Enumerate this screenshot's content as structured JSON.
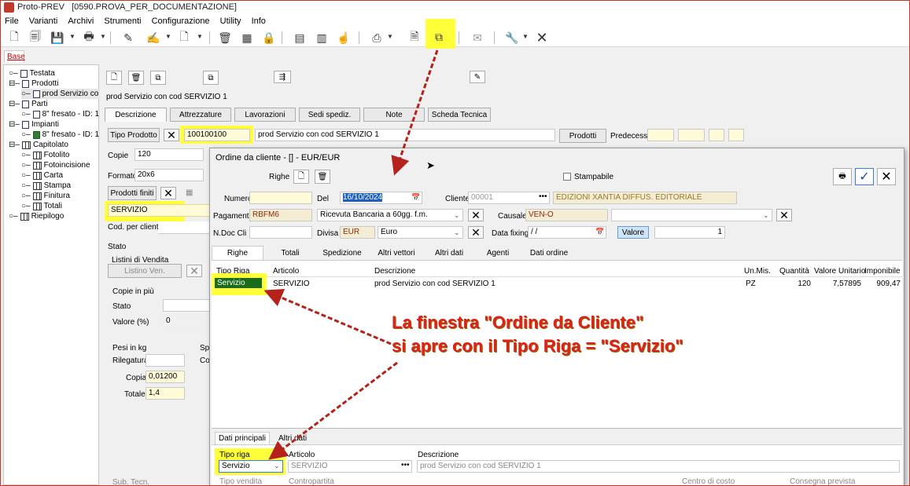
{
  "window": {
    "app_name": "Proto-PREV",
    "doc_name": "[0590.PROVA_PER_DOCUMENTAZIONE]"
  },
  "menu": [
    "File",
    "Varianti",
    "Archivi",
    "Strumenti",
    "Configurazione",
    "Utility",
    "Info"
  ],
  "toolbar_icons": [
    "new-doc-icon",
    "open-icon",
    "save-icon",
    "print-icon",
    "edit-icon",
    "edit-doc-icon",
    "page-icon",
    "trash-icon",
    "calc-icon",
    "lock-icon",
    "table-icon",
    "table-edit-icon",
    "hand-icon",
    "stamp-icon",
    "pdf-icon",
    "copy-order-icon",
    "mail-icon",
    "wrench-icon",
    "close-icon"
  ],
  "base_tab": "Base",
  "tree": {
    "items": [
      {
        "label": "Testata",
        "icon": "doc"
      },
      {
        "label": "Prodotti",
        "icon": "doc"
      },
      {
        "label": "prod Servizio co",
        "icon": "doc"
      },
      {
        "label": "Parti",
        "icon": "doc"
      },
      {
        "label": "8\" fresato - ID: 1",
        "icon": "doc"
      },
      {
        "label": "Impianti",
        "icon": "doc"
      },
      {
        "label": "8\" fresato - ID: 1",
        "icon": "green"
      },
      {
        "label": "Capitolato",
        "icon": "grid"
      },
      {
        "label": "Fotolito",
        "icon": "grid"
      },
      {
        "label": "Fotoincisione",
        "icon": "grid"
      },
      {
        "label": "Carta",
        "icon": "grid"
      },
      {
        "label": "Stampa",
        "icon": "grid"
      },
      {
        "label": "Finitura",
        "icon": "grid"
      },
      {
        "label": "Totali",
        "icon": "grid"
      },
      {
        "label": "Riepilogo",
        "icon": "grid"
      }
    ]
  },
  "product": {
    "header": "prod Servizio con cod SERVIZIO 1",
    "tabs": [
      "Descrizione",
      "Attrezzature",
      "Lavorazioni",
      "Sedi spediz.",
      "Note",
      "Scheda Tecnica"
    ],
    "tipo_prodotto_label": "Tipo Prodotto",
    "code": "100100100",
    "description": "prod Servizio con cod SERVIZIO 1",
    "prodotti_btn": "Prodotti",
    "predecess_label": "Predecess.",
    "copie_label": "Copie",
    "copie_value": "120",
    "formato_label": "Formato",
    "formato_value": "20x6",
    "prodotti_finiti_btn": "Prodotti finiti",
    "servizio_value": "SERVIZIO",
    "cod_cliente_label": "Cod. per cliente",
    "stato_label": "Stato",
    "listini_label": "Listini di Vendita",
    "listino_btn": "Listino Ven.",
    "copie_piu_label": "Copie in più",
    "stato2_label": "Stato",
    "valore_label": "Valore (%)",
    "valore_value": "0",
    "pesi_label": "Pesi in kg",
    "rilegatura_label": "Rilegatura",
    "copia_label": "Copia",
    "copia_value": "0,01200",
    "totale_label": "Totale",
    "totale_value": "1,4",
    "sp_label": "Sp",
    "co_label": "Co",
    "sub_tecn_label": "Sub. Tecn."
  },
  "dialog": {
    "title": "Ordine da cliente - [] - EUR/EUR",
    "righe_label": "Righe",
    "stampabile_label": "Stampabile",
    "numero_label": "Numero",
    "del_label": "Del",
    "del_value": "16/10/2024",
    "cliente_label": "Cliente",
    "cliente_code": "00001",
    "cliente_name": "EDIZIONI XANTIA DIFFUS. EDITORIALE",
    "pagamento_label": "Pagamento",
    "pagamento_code": "RBFM6",
    "pagamento_desc": "Ricevuta Bancaria a 60gg. f.m.",
    "causale_label": "Causale",
    "causale_value": "VEN-O",
    "ndoc_label": "N.Doc Cli",
    "divisa_label": "Divisa",
    "divisa_code": "EUR",
    "divisa_desc": "Euro",
    "data_fixing_label": "Data fixing",
    "data_fixing_value": "/ /",
    "valore_btn": "Valore",
    "valore_value": "1",
    "tabs": [
      "Righe",
      "Totali",
      "Spedizione",
      "Altri vettori",
      "Altri dati",
      "Agenti",
      "Dati ordine"
    ],
    "columns": [
      "Tipo Riga",
      "Articolo",
      "Descrizione",
      "Un.Mis.",
      "Quantità",
      "Valore Unitario",
      "Imponibile"
    ],
    "row": {
      "tipo": "Servizio",
      "articolo": "SERVIZIO",
      "descrizione": "prod Servizio con cod SERVIZIO 1",
      "um": "PZ",
      "qta": "120",
      "valore_unitario": "7,57895",
      "imponibile": "909,47"
    },
    "bottom_tabs": [
      "Dati principali",
      "Altri dati"
    ],
    "tipo_riga_label": "Tipo riga",
    "tipo_riga_value": "Servizio",
    "articolo_label": "Articolo",
    "articolo_value": "SERVIZIO",
    "descrizione_label": "Descrizione",
    "descrizione_value": "prod Servizio con cod SERVIZIO 1",
    "tipo_vendita_label": "Tipo vendita",
    "contropartita_label": "Contropartita",
    "centro_costo_label": "Centro di costo",
    "consegna_label": "Consegna prevista"
  },
  "annotation": {
    "line1": "La finestra \"Ordine da Cliente\"",
    "line2": "si apre con il Tipo Riga = \"Servizio\""
  },
  "colors": {
    "highlight": "#ffff3a",
    "annotation_red": "#e0201c",
    "selected_row": "#1a6b1a",
    "arrow_red": "#b5211b"
  }
}
